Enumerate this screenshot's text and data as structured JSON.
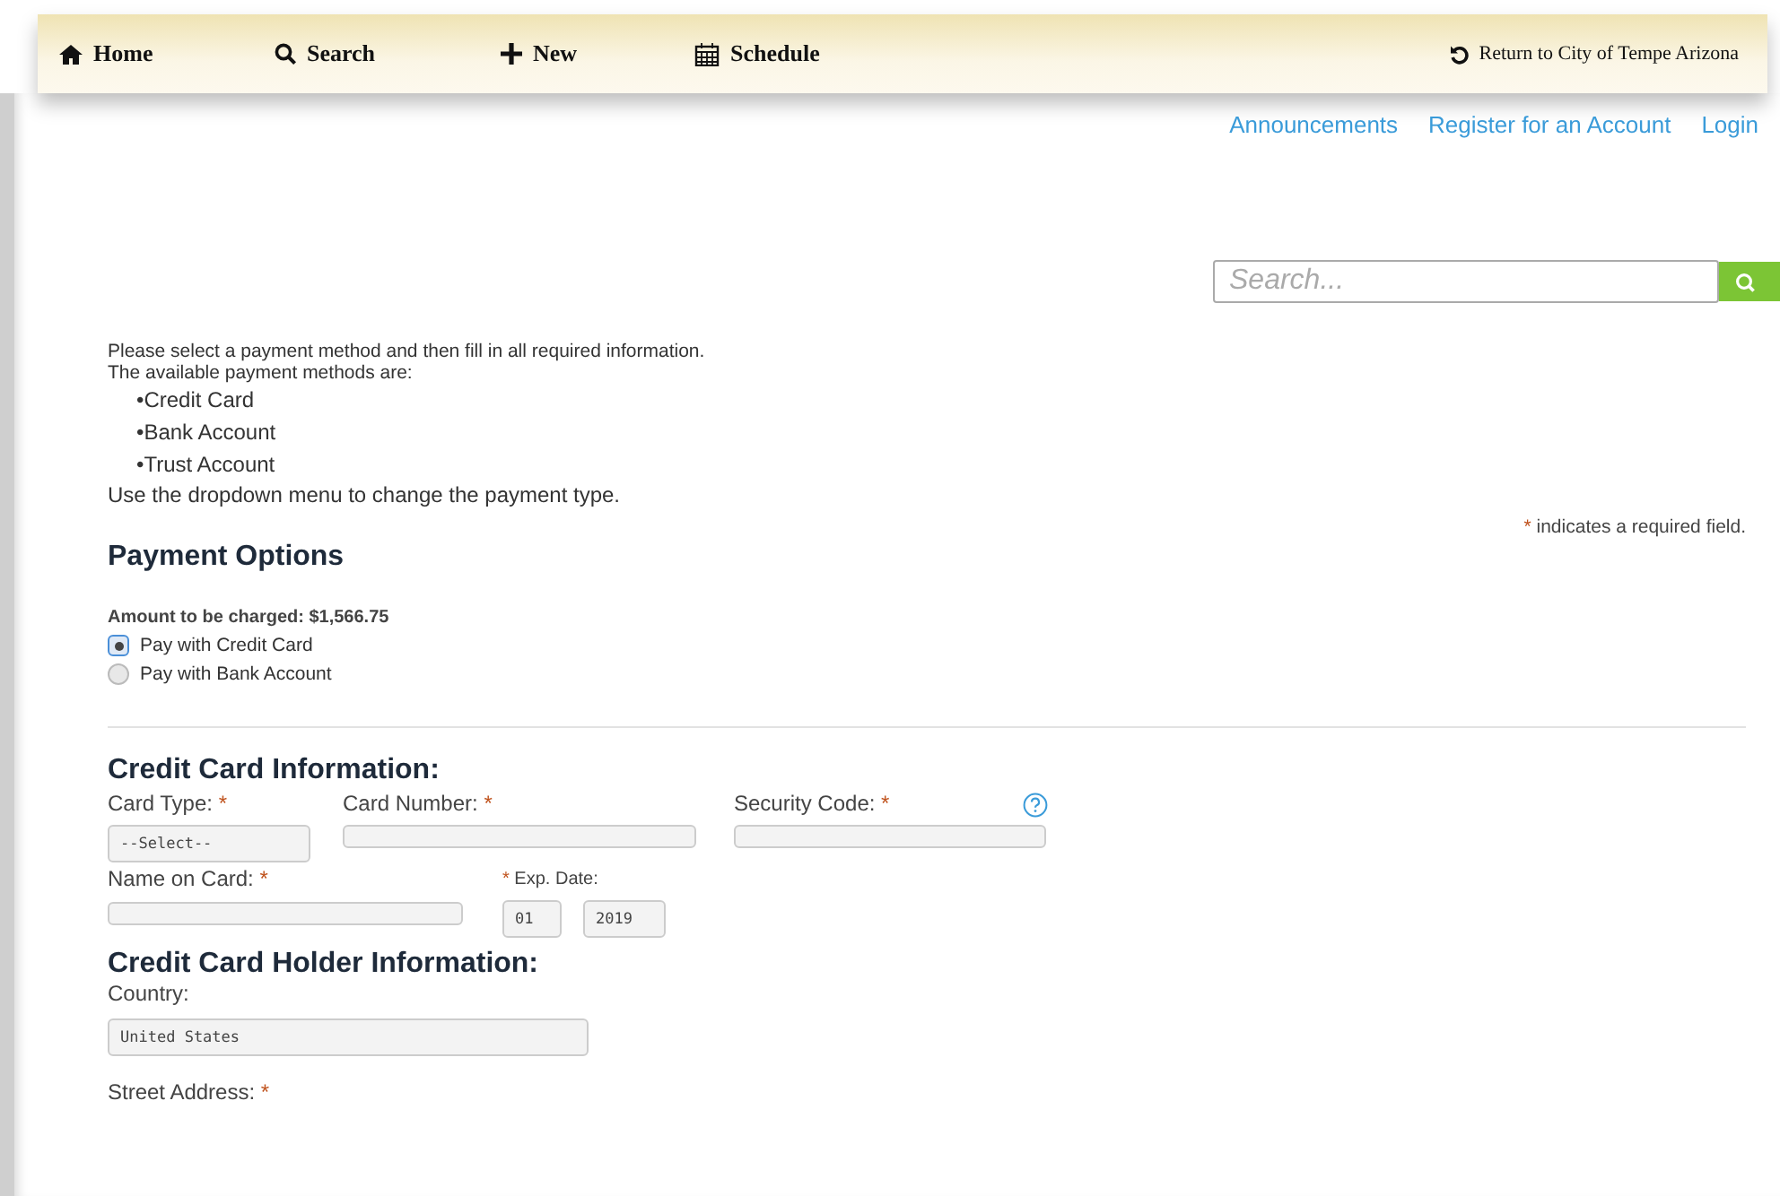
{
  "nav": {
    "items": [
      {
        "kind": "home",
        "label": "Home"
      },
      {
        "kind": "search",
        "label": "Search"
      },
      {
        "kind": "plus",
        "label": "New"
      },
      {
        "kind": "calendar",
        "label": "Schedule"
      }
    ],
    "return_link": "Return to City of Tempe Arizona"
  },
  "top_links": [
    "Announcements",
    "Register for an Account",
    "Login"
  ],
  "search": {
    "placeholder": "Search..."
  },
  "intro": {
    "lines": [
      "Please select a payment method and then fill in all required information.",
      "The available payment methods are:"
    ],
    "methods": [
      "•Credit Card",
      "•Bank Account",
      "•Trust Account"
    ],
    "footer": "Use the dropdown menu to change the payment type."
  },
  "required_note": {
    "mark": "*",
    "text": "indicates a required field."
  },
  "payment_options": {
    "title": "Payment Options",
    "amount": "Amount to be charged: $1,566.75",
    "choices": [
      {
        "label": "Pay with Credit Card",
        "selected": true
      },
      {
        "label": "Pay with Bank Account",
        "selected": false
      }
    ]
  },
  "card_info": {
    "title": "Credit Card Information:",
    "row_1": [
      {
        "label": "Card Type:",
        "mark": "*",
        "kind": "select",
        "value": "--Select--"
      },
      {
        "label": "Card Number:",
        "mark": "*",
        "kind": "text"
      },
      {
        "label": "Security Code:",
        "mark": "*",
        "kind": "text",
        "help": true
      }
    ],
    "row_2": [
      {
        "label": "Name on Card:",
        "mark": "*",
        "kind": "text"
      },
      {
        "label": "Exp. Date:",
        "mark": "*",
        "mark_first": true,
        "kind": "date",
        "values": [
          "01",
          "2019"
        ]
      }
    ]
  },
  "holder_info": {
    "title": "Credit Card Holder Information:",
    "country": {
      "label": "Country:",
      "value": "United States"
    },
    "street": {
      "label": "Street Address:",
      "mark": "*"
    }
  }
}
